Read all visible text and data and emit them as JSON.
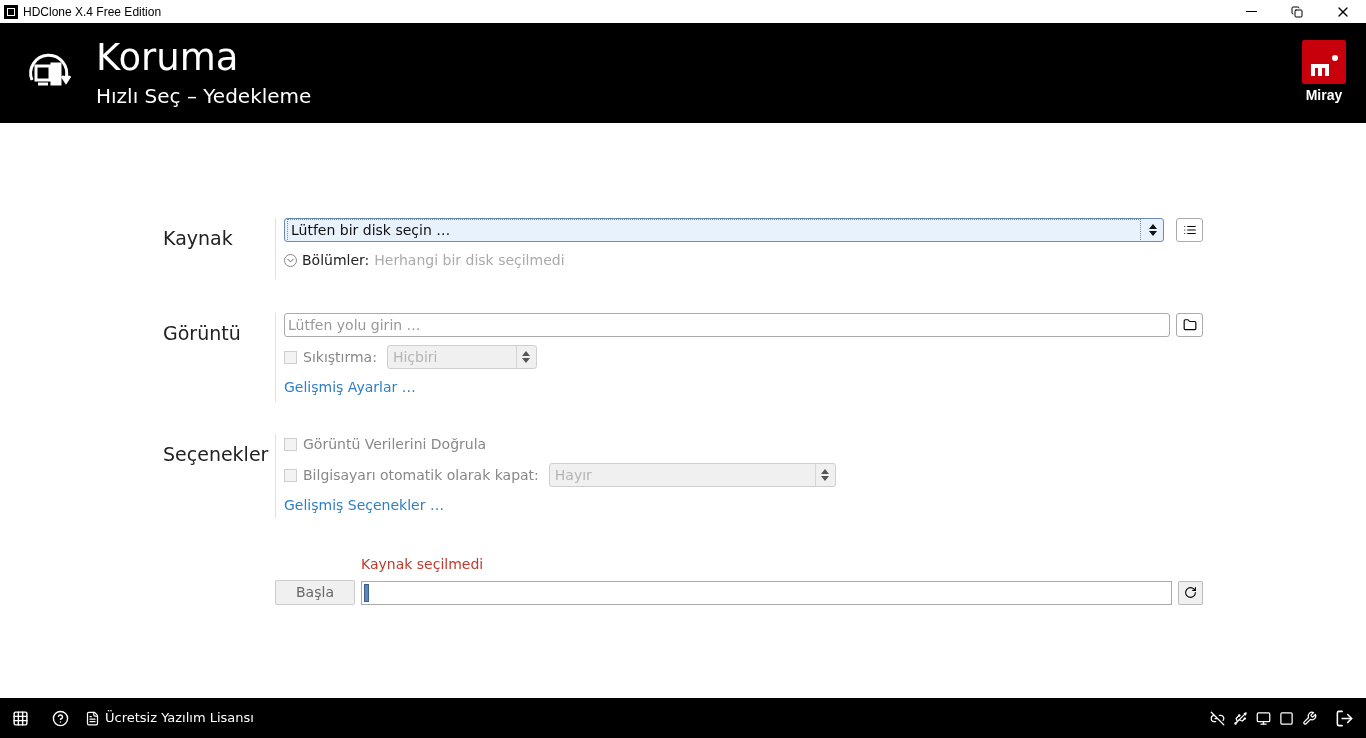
{
  "window": {
    "title": "HDClone X.4 Free Edition"
  },
  "header": {
    "title": "Koruma",
    "subtitle": "Hızlı Seç – Yedekleme",
    "brand": "Miray"
  },
  "source": {
    "label": "Kaynak",
    "select_value": "Lütfen bir disk seçin …",
    "partitions_label": "Bölümler:",
    "partitions_value": "Herhangi bir disk seçilmedi"
  },
  "image": {
    "label": "Görüntü",
    "path": {
      "placeholder": "Lütfen yolu girin …"
    },
    "compression": {
      "label": "Sıkıştırma:",
      "checked": false,
      "disabled": true,
      "value": "Hiçbiri"
    },
    "link": "Gelişmiş Ayarlar …"
  },
  "options": {
    "label": "Seçenekler",
    "items": [
      {
        "kind": "checkbox",
        "label": "Görüntü Verilerini Doğrula",
        "checked": false,
        "disabled": true
      },
      {
        "kind": "checkbox-select",
        "label": "Bilgisayarı otomatik olarak kapat:",
        "checked": false,
        "disabled": true,
        "value": "Hayır"
      }
    ],
    "link": "Gelişmiş Seçenekler …"
  },
  "run": {
    "status": "Kaynak seçilmedi",
    "start_button": "Başla",
    "start_disabled": true,
    "progress": {
      "level": 0.006
    }
  },
  "status_bar": {
    "license": "Ücretsiz Yazılım Lisansı"
  }
}
